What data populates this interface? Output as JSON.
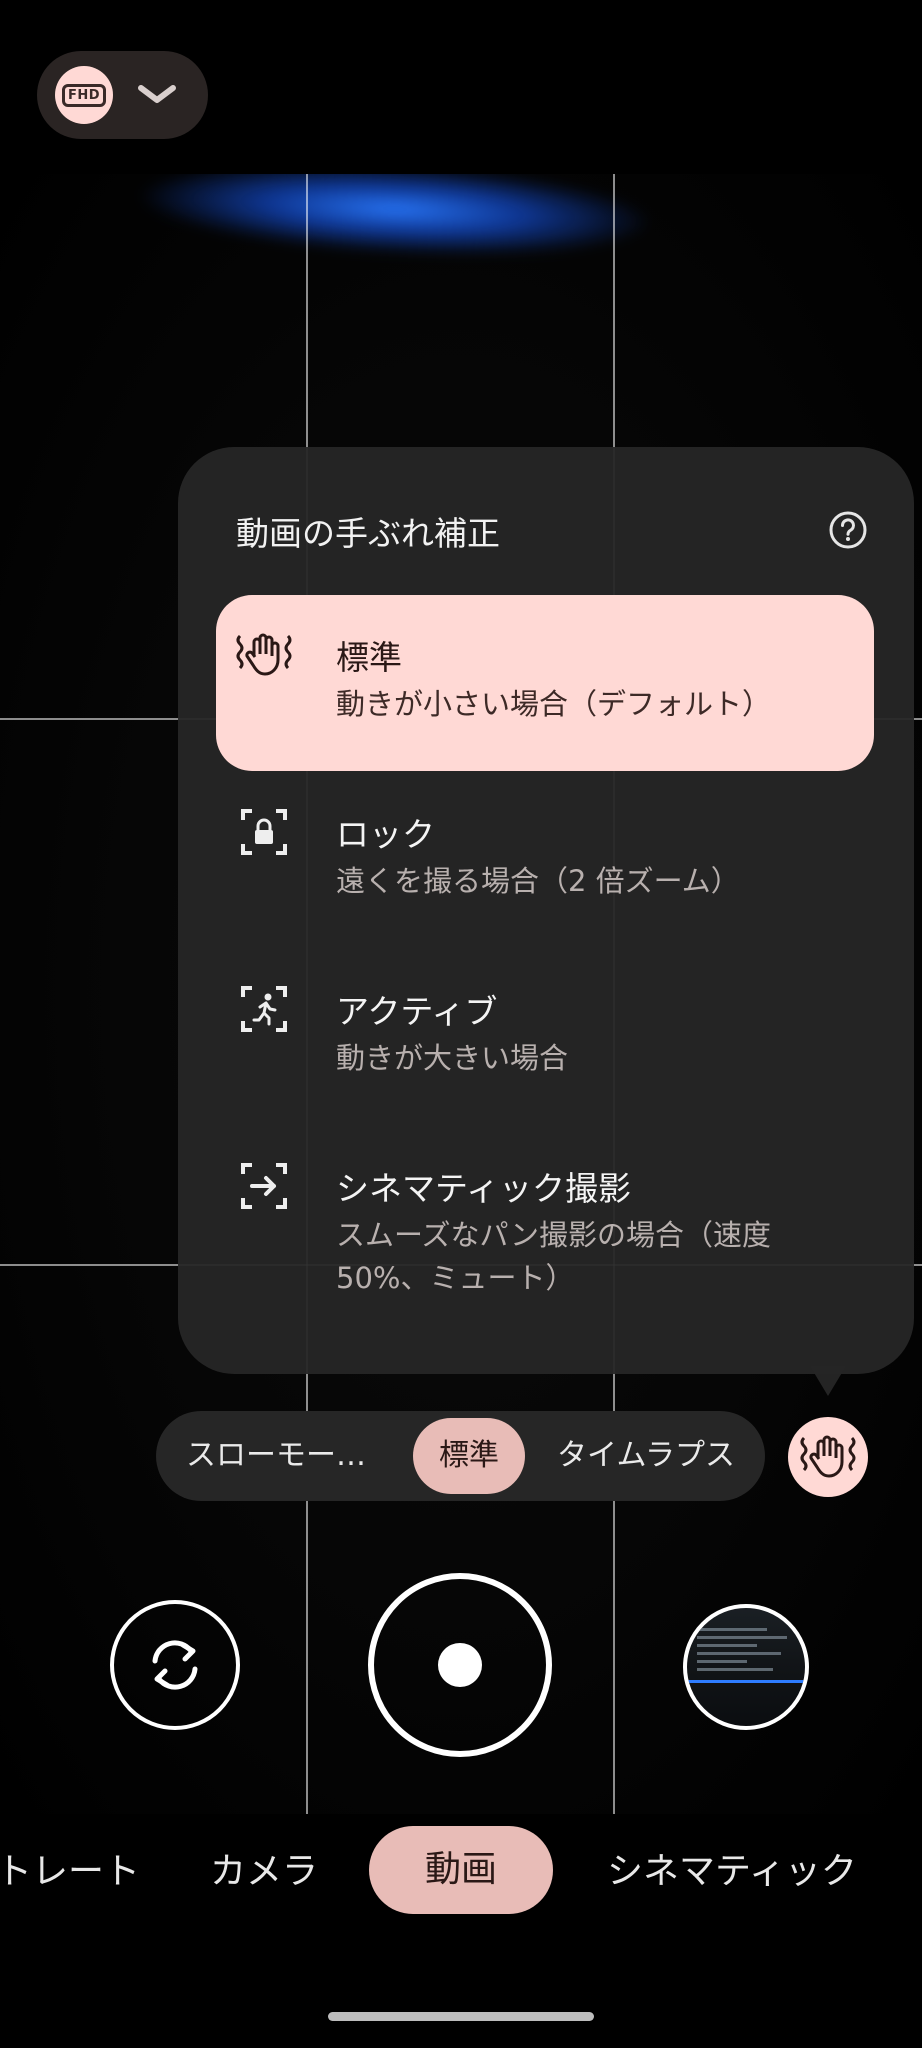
{
  "top": {
    "resolution_label": "FHD",
    "resolution_icon": "fhd-icon",
    "dropdown_icon": "chevron-down-icon"
  },
  "stabilization_popup": {
    "title": "動画の手ぶれ補正",
    "help_icon": "help-circle-icon",
    "options": [
      {
        "title": "標準",
        "subtitle": "動きが小さい場合（デフォルト）",
        "icon": "hand-shake-icon",
        "selected": true
      },
      {
        "title": "ロック",
        "subtitle": "遠くを撮る場合（2 倍ズーム）",
        "icon": "lock-frame-icon",
        "selected": false
      },
      {
        "title": "アクティブ",
        "subtitle": "動きが大きい場合",
        "icon": "running-person-frame-icon",
        "selected": false
      },
      {
        "title": "シネマティック撮影",
        "subtitle": "スムーズなパン撮影の場合（速度 50%、ミュート）",
        "icon": "pan-arrow-frame-icon",
        "selected": false
      }
    ]
  },
  "speed_selector": {
    "items": [
      "スローモー…",
      "標準",
      "タイムラプス"
    ],
    "selected": "標準",
    "stabilization_button_icon": "hand-shake-icon"
  },
  "controls": {
    "flip_icon": "camera-flip-icon",
    "shutter_icon": "record-icon",
    "gallery_icon": "gallery-thumbnail"
  },
  "modes": {
    "items": [
      "トレート",
      "カメラ",
      "動画",
      "シネマティック"
    ],
    "selected": "動画"
  },
  "colors": {
    "accent": "#ffd9d5",
    "accent_dim": "#e8bcb7",
    "panel": "#262626"
  }
}
